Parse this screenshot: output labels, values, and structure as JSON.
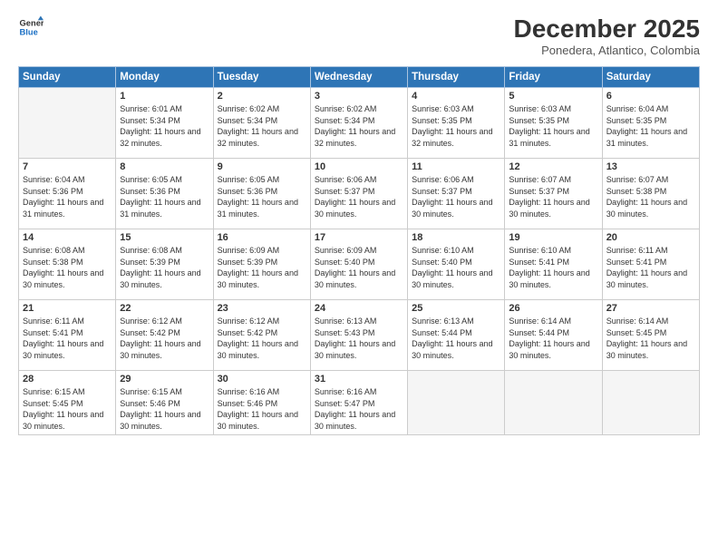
{
  "logo": {
    "line1": "General",
    "line2": "Blue"
  },
  "title": "December 2025",
  "subtitle": "Ponedera, Atlantico, Colombia",
  "days_of_week": [
    "Sunday",
    "Monday",
    "Tuesday",
    "Wednesday",
    "Thursday",
    "Friday",
    "Saturday"
  ],
  "weeks": [
    [
      {
        "day": "",
        "info": ""
      },
      {
        "day": "1",
        "info": "Sunrise: 6:01 AM\nSunset: 5:34 PM\nDaylight: 11 hours\nand 32 minutes."
      },
      {
        "day": "2",
        "info": "Sunrise: 6:02 AM\nSunset: 5:34 PM\nDaylight: 11 hours\nand 32 minutes."
      },
      {
        "day": "3",
        "info": "Sunrise: 6:02 AM\nSunset: 5:34 PM\nDaylight: 11 hours\nand 32 minutes."
      },
      {
        "day": "4",
        "info": "Sunrise: 6:03 AM\nSunset: 5:35 PM\nDaylight: 11 hours\nand 32 minutes."
      },
      {
        "day": "5",
        "info": "Sunrise: 6:03 AM\nSunset: 5:35 PM\nDaylight: 11 hours\nand 31 minutes."
      },
      {
        "day": "6",
        "info": "Sunrise: 6:04 AM\nSunset: 5:35 PM\nDaylight: 11 hours\nand 31 minutes."
      }
    ],
    [
      {
        "day": "7",
        "info": "Sunrise: 6:04 AM\nSunset: 5:36 PM\nDaylight: 11 hours\nand 31 minutes."
      },
      {
        "day": "8",
        "info": "Sunrise: 6:05 AM\nSunset: 5:36 PM\nDaylight: 11 hours\nand 31 minutes."
      },
      {
        "day": "9",
        "info": "Sunrise: 6:05 AM\nSunset: 5:36 PM\nDaylight: 11 hours\nand 31 minutes."
      },
      {
        "day": "10",
        "info": "Sunrise: 6:06 AM\nSunset: 5:37 PM\nDaylight: 11 hours\nand 30 minutes."
      },
      {
        "day": "11",
        "info": "Sunrise: 6:06 AM\nSunset: 5:37 PM\nDaylight: 11 hours\nand 30 minutes."
      },
      {
        "day": "12",
        "info": "Sunrise: 6:07 AM\nSunset: 5:37 PM\nDaylight: 11 hours\nand 30 minutes."
      },
      {
        "day": "13",
        "info": "Sunrise: 6:07 AM\nSunset: 5:38 PM\nDaylight: 11 hours\nand 30 minutes."
      }
    ],
    [
      {
        "day": "14",
        "info": "Sunrise: 6:08 AM\nSunset: 5:38 PM\nDaylight: 11 hours\nand 30 minutes."
      },
      {
        "day": "15",
        "info": "Sunrise: 6:08 AM\nSunset: 5:39 PM\nDaylight: 11 hours\nand 30 minutes."
      },
      {
        "day": "16",
        "info": "Sunrise: 6:09 AM\nSunset: 5:39 PM\nDaylight: 11 hours\nand 30 minutes."
      },
      {
        "day": "17",
        "info": "Sunrise: 6:09 AM\nSunset: 5:40 PM\nDaylight: 11 hours\nand 30 minutes."
      },
      {
        "day": "18",
        "info": "Sunrise: 6:10 AM\nSunset: 5:40 PM\nDaylight: 11 hours\nand 30 minutes."
      },
      {
        "day": "19",
        "info": "Sunrise: 6:10 AM\nSunset: 5:41 PM\nDaylight: 11 hours\nand 30 minutes."
      },
      {
        "day": "20",
        "info": "Sunrise: 6:11 AM\nSunset: 5:41 PM\nDaylight: 11 hours\nand 30 minutes."
      }
    ],
    [
      {
        "day": "21",
        "info": "Sunrise: 6:11 AM\nSunset: 5:41 PM\nDaylight: 11 hours\nand 30 minutes."
      },
      {
        "day": "22",
        "info": "Sunrise: 6:12 AM\nSunset: 5:42 PM\nDaylight: 11 hours\nand 30 minutes."
      },
      {
        "day": "23",
        "info": "Sunrise: 6:12 AM\nSunset: 5:42 PM\nDaylight: 11 hours\nand 30 minutes."
      },
      {
        "day": "24",
        "info": "Sunrise: 6:13 AM\nSunset: 5:43 PM\nDaylight: 11 hours\nand 30 minutes."
      },
      {
        "day": "25",
        "info": "Sunrise: 6:13 AM\nSunset: 5:44 PM\nDaylight: 11 hours\nand 30 minutes."
      },
      {
        "day": "26",
        "info": "Sunrise: 6:14 AM\nSunset: 5:44 PM\nDaylight: 11 hours\nand 30 minutes."
      },
      {
        "day": "27",
        "info": "Sunrise: 6:14 AM\nSunset: 5:45 PM\nDaylight: 11 hours\nand 30 minutes."
      }
    ],
    [
      {
        "day": "28",
        "info": "Sunrise: 6:15 AM\nSunset: 5:45 PM\nDaylight: 11 hours\nand 30 minutes."
      },
      {
        "day": "29",
        "info": "Sunrise: 6:15 AM\nSunset: 5:46 PM\nDaylight: 11 hours\nand 30 minutes."
      },
      {
        "day": "30",
        "info": "Sunrise: 6:16 AM\nSunset: 5:46 PM\nDaylight: 11 hours\nand 30 minutes."
      },
      {
        "day": "31",
        "info": "Sunrise: 6:16 AM\nSunset: 5:47 PM\nDaylight: 11 hours\nand 30 minutes."
      },
      {
        "day": "",
        "info": ""
      },
      {
        "day": "",
        "info": ""
      },
      {
        "day": "",
        "info": ""
      }
    ]
  ]
}
